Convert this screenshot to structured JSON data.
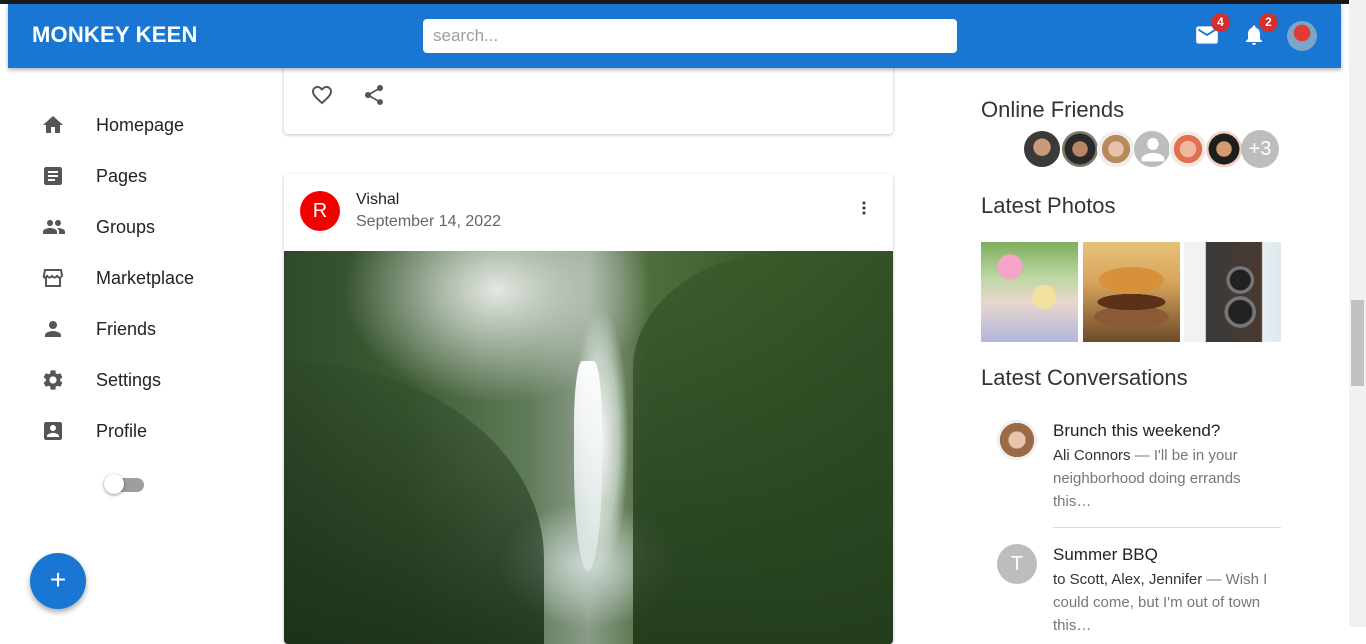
{
  "app": {
    "title": "MONKEY KEEN"
  },
  "search": {
    "placeholder": "search..."
  },
  "header": {
    "mail_count": "4",
    "notification_count": "2"
  },
  "colors": {
    "primary": "#1976d2",
    "badge": "#d32f2f",
    "post_avatar": "#f20000"
  },
  "sidebar": {
    "items": [
      {
        "label": "Homepage",
        "icon": "home-icon"
      },
      {
        "label": "Pages",
        "icon": "article-icon"
      },
      {
        "label": "Groups",
        "icon": "group-icon"
      },
      {
        "label": "Marketplace",
        "icon": "storefront-icon"
      },
      {
        "label": "Friends",
        "icon": "person-icon"
      },
      {
        "label": "Settings",
        "icon": "gear-icon"
      },
      {
        "label": "Profile",
        "icon": "account-box-icon"
      }
    ],
    "dark_mode_enabled": false,
    "fab_label": "+"
  },
  "post": {
    "avatar_letter": "R",
    "author": "Vishal",
    "date": "September 14, 2022"
  },
  "right": {
    "online_title": "Online Friends",
    "online_more": "+3",
    "photos_title": "Latest Photos",
    "conversations_title": "Latest Conversations",
    "conversations": [
      {
        "title": "Brunch this weekend?",
        "from": "Ali Connors",
        "preview": " — I'll be in your neighborhood doing errands this…"
      },
      {
        "title": "Summer BBQ",
        "avatar_letter": "T",
        "from": "to Scott, Alex, Jennifer",
        "preview": " — Wish I could come, but I'm out of town this…"
      }
    ]
  }
}
